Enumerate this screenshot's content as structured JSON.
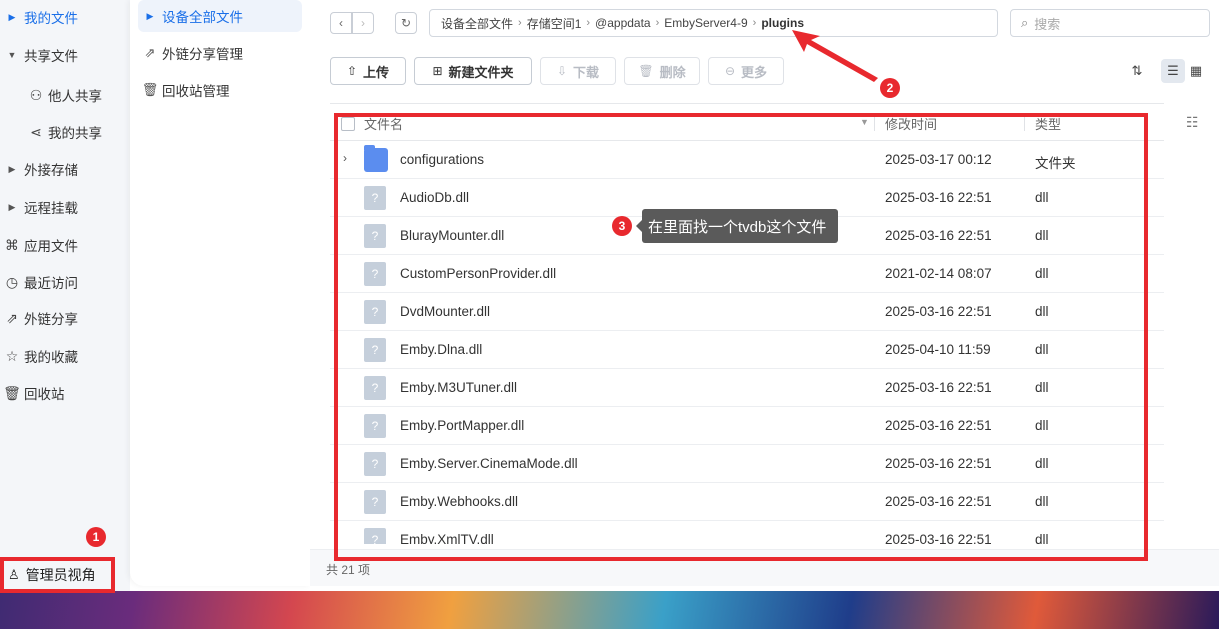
{
  "nav_primary": {
    "items": [
      {
        "label": "我的文件",
        "kind": "tree",
        "active": true
      },
      {
        "label": "共享文件",
        "kind": "tree"
      },
      {
        "label": "他人共享",
        "kind": "sub",
        "icon": "users-icon"
      },
      {
        "label": "我的共享",
        "kind": "sub",
        "icon": "share-icon"
      },
      {
        "label": "外接存储",
        "kind": "tree"
      },
      {
        "label": "远程挂载",
        "kind": "tree"
      },
      {
        "label": "应用文件",
        "kind": "icon",
        "icon": "apps-icon"
      },
      {
        "label": "最近访问",
        "kind": "icon",
        "icon": "clock-icon"
      },
      {
        "label": "外链分享",
        "kind": "icon",
        "icon": "link-share-icon"
      },
      {
        "label": "我的收藏",
        "kind": "icon",
        "icon": "star-icon"
      },
      {
        "label": "回收站",
        "kind": "icon",
        "icon": "trash-icon"
      }
    ],
    "admin_label": "管理员视角"
  },
  "nav_secondary": {
    "items": [
      {
        "label": "设备全部文件",
        "active": true
      },
      {
        "label": "外链分享管理",
        "icon": "link-share-icon"
      },
      {
        "label": "回收站管理",
        "icon": "trash-icon"
      }
    ]
  },
  "breadcrumb": [
    "设备全部文件",
    "存储空间1",
    "@appdata",
    "EmbyServer4-9",
    "plugins"
  ],
  "search": {
    "placeholder": "搜索"
  },
  "toolbar": {
    "upload": "上传",
    "new_folder": "新建文件夹",
    "download": "下载",
    "delete": "删除",
    "more": "更多"
  },
  "table": {
    "columns": {
      "name": "文件名",
      "modified": "修改时间",
      "type": "类型"
    },
    "rows": [
      {
        "name": "configurations",
        "date": "2025-03-17 00:12",
        "type": "文件夹",
        "folder": true
      },
      {
        "name": "AudioDb.dll",
        "date": "2025-03-16 22:51",
        "type": "dll"
      },
      {
        "name": "BlurayMounter.dll",
        "date": "2025-03-16 22:51",
        "type": "dll"
      },
      {
        "name": "CustomPersonProvider.dll",
        "date": "2021-02-14 08:07",
        "type": "dll"
      },
      {
        "name": "DvdMounter.dll",
        "date": "2025-03-16 22:51",
        "type": "dll"
      },
      {
        "name": "Emby.Dlna.dll",
        "date": "2025-04-10 11:59",
        "type": "dll"
      },
      {
        "name": "Emby.M3UTuner.dll",
        "date": "2025-03-16 22:51",
        "type": "dll"
      },
      {
        "name": "Emby.PortMapper.dll",
        "date": "2025-03-16 22:51",
        "type": "dll"
      },
      {
        "name": "Emby.Server.CinemaMode.dll",
        "date": "2025-03-16 22:51",
        "type": "dll"
      },
      {
        "name": "Emby.Webhooks.dll",
        "date": "2025-03-16 22:51",
        "type": "dll"
      },
      {
        "name": "Emby.XmlTV.dll",
        "date": "2025-03-16 22:51",
        "type": "dll"
      }
    ]
  },
  "footer": {
    "count": "共 21 项"
  },
  "annotations": {
    "badge1": "1",
    "badge2": "2",
    "badge3": "3",
    "tooltip": "在里面找一个tvdb这个文件",
    "color": "#e8292e"
  }
}
